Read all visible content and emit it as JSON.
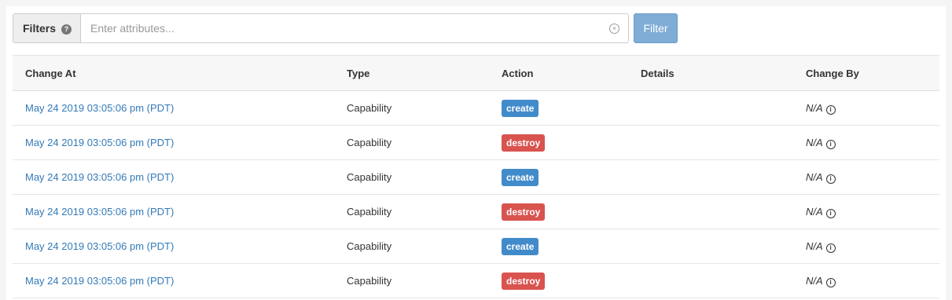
{
  "filters": {
    "label": "Filters",
    "help_icon": "question-circle-icon",
    "placeholder": "Enter attributes...",
    "value": "",
    "clear_icon": "clear-circle-icon",
    "button_label": "Filter"
  },
  "table": {
    "columns": [
      "Change At",
      "Type",
      "Action",
      "Details",
      "Change By"
    ],
    "rows": [
      {
        "change_at": "May 24 2019 03:05:06 pm (PDT)",
        "type": "Capability",
        "action": "create",
        "details": "",
        "change_by": "N/A"
      },
      {
        "change_at": "May 24 2019 03:05:06 pm (PDT)",
        "type": "Capability",
        "action": "destroy",
        "details": "",
        "change_by": "N/A"
      },
      {
        "change_at": "May 24 2019 03:05:06 pm (PDT)",
        "type": "Capability",
        "action": "create",
        "details": "",
        "change_by": "N/A"
      },
      {
        "change_at": "May 24 2019 03:05:06 pm (PDT)",
        "type": "Capability",
        "action": "destroy",
        "details": "",
        "change_by": "N/A"
      },
      {
        "change_at": "May 24 2019 03:05:06 pm (PDT)",
        "type": "Capability",
        "action": "create",
        "details": "",
        "change_by": "N/A"
      },
      {
        "change_at": "May 24 2019 03:05:06 pm (PDT)",
        "type": "Capability",
        "action": "destroy",
        "details": "",
        "change_by": "N/A"
      }
    ]
  },
  "colors": {
    "link": "#337ab7",
    "create_badge": "#428bca",
    "destroy_badge": "#d9534f",
    "filter_button": "#7fadd6"
  }
}
